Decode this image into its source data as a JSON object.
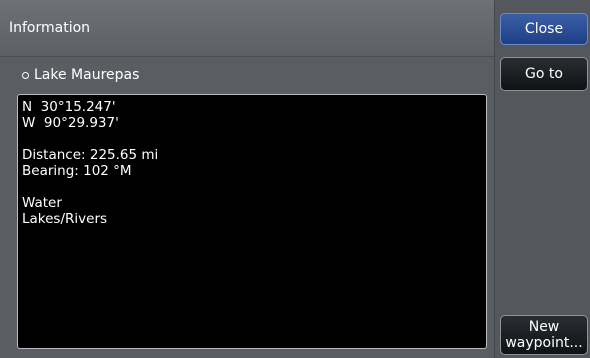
{
  "window": {
    "title": "Information"
  },
  "place": {
    "name": "Lake Maurepas",
    "icon": "circle-icon"
  },
  "info": {
    "lat": "N  30°15.247'",
    "lon": "W  90°29.937'",
    "distance": "Distance: 225.65 mi",
    "bearing": "Bearing: 102 °M",
    "type": "Water",
    "subtype": "Lakes/Rivers"
  },
  "buttons": {
    "close": "Close",
    "goto": "Go to",
    "new_line1": "New",
    "new_line2": "waypoint..."
  },
  "colors": {
    "accent": "#2b4f9a",
    "background": "#5a5f64",
    "textbox": "#000000"
  }
}
